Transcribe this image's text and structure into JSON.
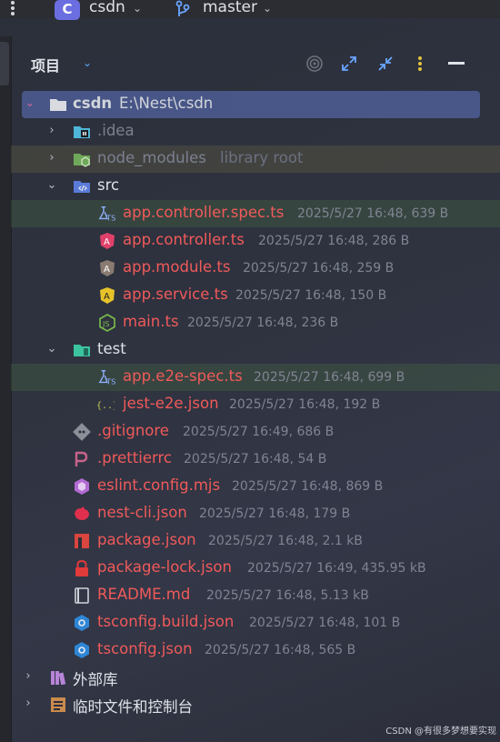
{
  "topbar": {
    "project_badge": "C",
    "project_name": "csdn",
    "branch": "master"
  },
  "panel": {
    "title": "项目"
  },
  "tree": {
    "root": {
      "name": "csdn",
      "path": "E:\\Nest\\csdn"
    },
    "idea": ".idea",
    "node_modules": {
      "name": "node_modules",
      "note": "library root"
    },
    "src": "src",
    "src_files": [
      {
        "name": "app.controller.spec.ts",
        "meta": "2025/5/27 16:48, 639 B"
      },
      {
        "name": "app.controller.ts",
        "meta": "2025/5/27 16:48, 286 B"
      },
      {
        "name": "app.module.ts",
        "meta": "2025/5/27 16:48, 259 B"
      },
      {
        "name": "app.service.ts",
        "meta": "2025/5/27 16:48, 150 B"
      },
      {
        "name": "main.ts",
        "meta": "2025/5/27 16:48, 236 B"
      }
    ],
    "test": "test",
    "test_files": [
      {
        "name": "app.e2e-spec.ts",
        "meta": "2025/5/27 16:48, 699 B"
      },
      {
        "name": "jest-e2e.json",
        "meta": "2025/5/27 16:48, 192 B"
      }
    ],
    "root_files": [
      {
        "name": ".gitignore",
        "meta": "2025/5/27 16:49, 686 B"
      },
      {
        "name": ".prettierrc",
        "meta": "2025/5/27 16:48, 54 B"
      },
      {
        "name": "eslint.config.mjs",
        "meta": "2025/5/27 16:48, 869 B"
      },
      {
        "name": "nest-cli.json",
        "meta": "2025/5/27 16:48, 179 B"
      },
      {
        "name": "package.json",
        "meta": "2025/5/27 16:48, 2.1 kB"
      },
      {
        "name": "package-lock.json",
        "meta": "2025/5/27 16:49, 435.95 kB"
      },
      {
        "name": "README.md",
        "meta": "2025/5/27 16:48, 5.13 kB"
      },
      {
        "name": "tsconfig.build.json",
        "meta": "2025/5/27 16:48, 101 B"
      },
      {
        "name": "tsconfig.json",
        "meta": "2025/5/27 16:48, 565 B"
      }
    ],
    "external_libs": "外部库",
    "scratches": "临时文件和控制台"
  },
  "watermark": "CSDN @有很多梦想要实现",
  "colors": {
    "selection": "#4b5a8e",
    "accent": "#6b6ee0",
    "modified_red": "#f05a5a"
  }
}
